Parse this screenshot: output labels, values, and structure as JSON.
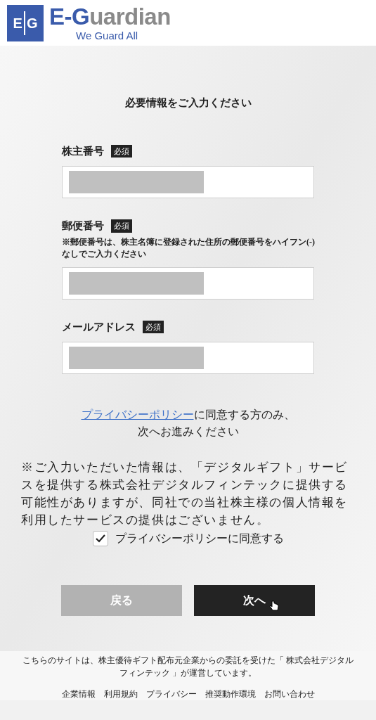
{
  "header": {
    "logo_letters": [
      "E",
      "G"
    ],
    "wordmark": [
      "E-G",
      "uardian"
    ],
    "tagline": "We Guard All"
  },
  "form": {
    "title": "必要情報をご入力ください",
    "fields": [
      {
        "label": "株主番号",
        "badge": "必須",
        "redacted": true
      },
      {
        "label": "郵便番号",
        "badge": "必須",
        "note": "※郵便番号は、株主名簿に登録された住所の郵便番号をハイフン(-)なしでご入力ください",
        "redacted": true
      },
      {
        "label": "メールアドレス",
        "badge": "必須",
        "redacted": true
      }
    ],
    "consent": {
      "link": "プライバシーポリシー",
      "text_after": "に同意する方のみ、",
      "line2": "次へお進みください"
    },
    "notice": "※ご入力いただいた情報は、「デジタルギフト」サービスを提供する株式会社デジタルフィンテックに提供する可能性がありますが、同社での当社株主様の個人情報を利用したサービスの提供はございません。",
    "checkbox": {
      "label": "プライバシーポリシーに同意する",
      "checked": true
    },
    "buttons": [
      {
        "label": "戻る",
        "kind": "secondary"
      },
      {
        "label": "次へ",
        "kind": "primary"
      }
    ]
  },
  "footer": {
    "text": "こちらのサイトは、株主優待ギフト配布元企業からの委託を受けた「 株式会社デジタルフィンテック 」が運営しています。",
    "links": [
      "企業情報",
      "利用規約",
      "プライバシー",
      "推奨動作環境",
      "お問い合わせ"
    ]
  }
}
